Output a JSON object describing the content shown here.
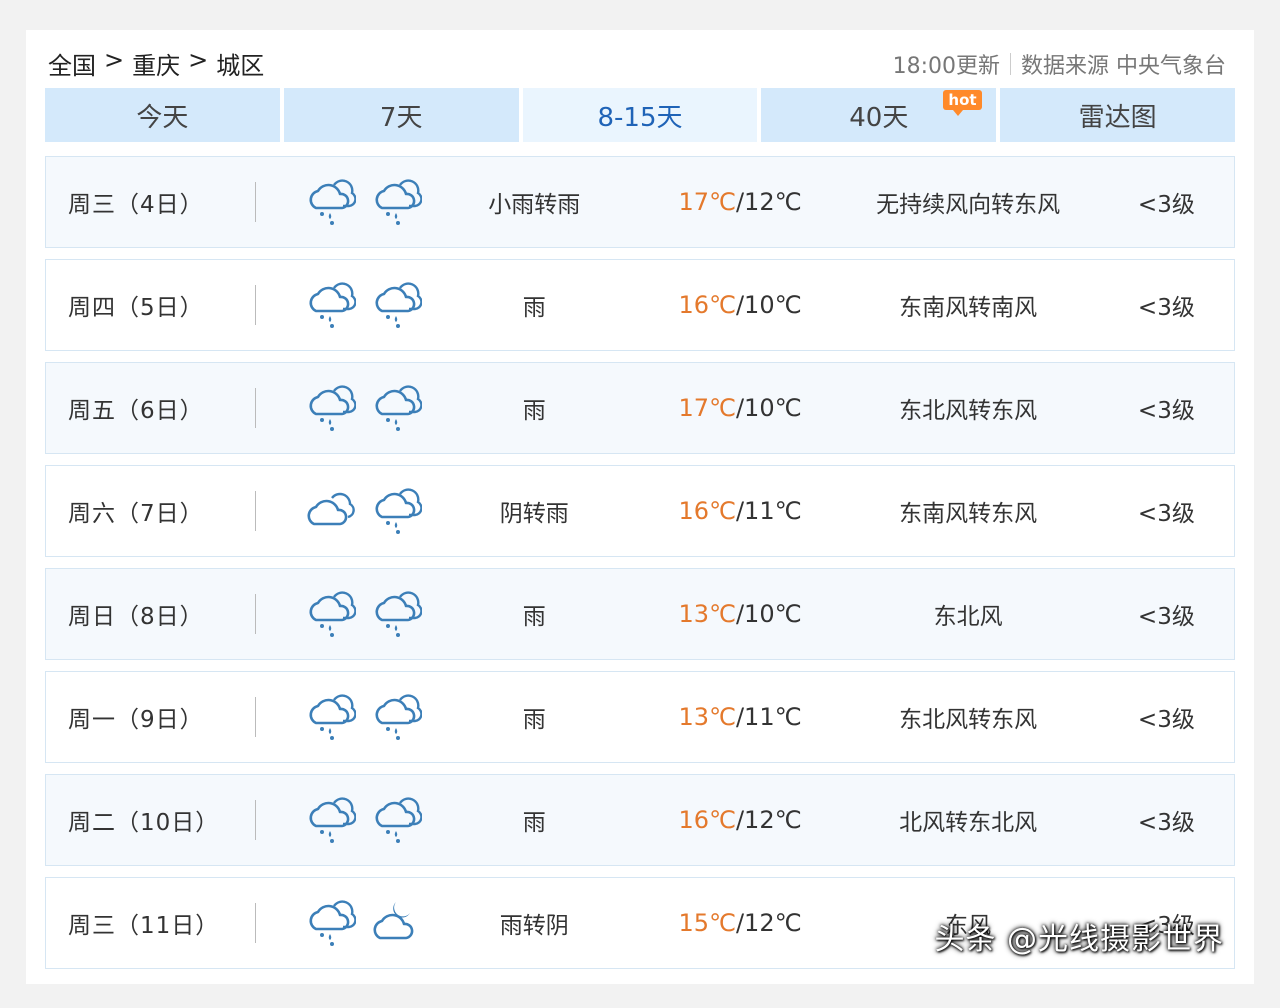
{
  "breadcrumb": [
    "全国",
    "重庆",
    "城区"
  ],
  "breadcrumb_sep": ">",
  "meta": {
    "update": "18:00更新",
    "source": "数据来源 中央气象台"
  },
  "tabs": [
    {
      "label": "今天"
    },
    {
      "label": "7天"
    },
    {
      "label": "8-15天",
      "active": true
    },
    {
      "label": "40天",
      "badge": "hot"
    },
    {
      "label": "雷达图"
    }
  ],
  "forecast": [
    {
      "day": "周三（4日）",
      "icon1": "cloud-rain-icon",
      "icon2": "cloud-rain-icon",
      "weather": "小雨转雨",
      "hi": "17℃",
      "lo": "/12℃",
      "wind": "无持续风向转东风",
      "level": "<3级"
    },
    {
      "day": "周四（5日）",
      "icon1": "cloud-rain-icon",
      "icon2": "cloud-rain-icon",
      "weather": "雨",
      "hi": "16℃",
      "lo": "/10℃",
      "wind": "东南风转南风",
      "level": "<3级"
    },
    {
      "day": "周五（6日）",
      "icon1": "cloud-rain-icon",
      "icon2": "cloud-rain-icon",
      "weather": "雨",
      "hi": "17℃",
      "lo": "/10℃",
      "wind": "东北风转东风",
      "level": "<3级"
    },
    {
      "day": "周六（7日）",
      "icon1": "cloud-overcast-icon",
      "icon2": "cloud-rain-icon",
      "weather": "阴转雨",
      "hi": "16℃",
      "lo": "/11℃",
      "wind": "东南风转东风",
      "level": "<3级"
    },
    {
      "day": "周日（8日）",
      "icon1": "cloud-rain-icon",
      "icon2": "cloud-rain-icon",
      "weather": "雨",
      "hi": "13℃",
      "lo": "/10℃",
      "wind": "东北风",
      "level": "<3级"
    },
    {
      "day": "周一（9日）",
      "icon1": "cloud-rain-icon",
      "icon2": "cloud-rain-icon",
      "weather": "雨",
      "hi": "13℃",
      "lo": "/11℃",
      "wind": "东北风转东风",
      "level": "<3级"
    },
    {
      "day": "周二（10日）",
      "icon1": "cloud-rain-icon",
      "icon2": "cloud-rain-icon",
      "weather": "雨",
      "hi": "16℃",
      "lo": "/12℃",
      "wind": "北风转东北风",
      "level": "<3级"
    },
    {
      "day": "周三（11日）",
      "icon1": "cloud-rain-icon",
      "icon2": "cloud-moon-icon",
      "weather": "雨转阴",
      "hi": "15℃",
      "lo": "/12℃",
      "wind": "东风",
      "level": "<3级"
    }
  ],
  "watermark": "头条 @光线摄影世界",
  "colors": {
    "tab_bg": "#d4e9fb",
    "tab_active_bg": "#eaf5fe",
    "tab_active_text": "#1f63b7",
    "temp_hi": "#e4792c",
    "hot_badge": "#ff8a2a",
    "icon_blue": "#3c7fb8"
  }
}
